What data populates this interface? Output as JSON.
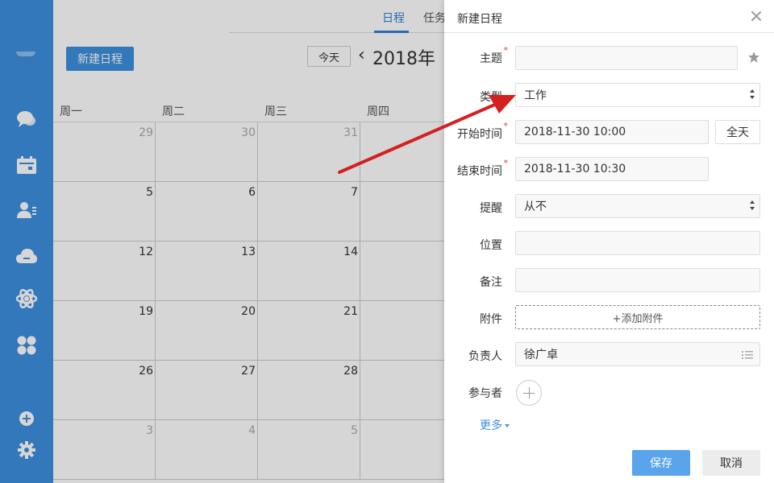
{
  "nav": {
    "tab_schedule": "日程",
    "tab_tasks": "任务"
  },
  "toolbar": {
    "new_schedule": "新建日程",
    "today": "今天",
    "prev": "‹",
    "year": "2018年 "
  },
  "weekdays": [
    "周一",
    "周二",
    "周三",
    "周四"
  ],
  "calendar": {
    "rows": [
      [
        "29",
        "30",
        "31",
        ""
      ],
      [
        "5",
        "6",
        "7",
        ""
      ],
      [
        "12",
        "13",
        "14",
        ""
      ],
      [
        "19",
        "20",
        "21",
        ""
      ],
      [
        "26",
        "27",
        "28",
        ""
      ],
      [
        "3",
        "4",
        "5",
        ""
      ]
    ]
  },
  "dialog": {
    "title": "新建日程",
    "subject_label": "主题",
    "subject_value": "",
    "type_label": "类型",
    "type_value": "工作",
    "start_label": "开始时间",
    "start_value": "2018-11-30 10:00",
    "allday": "全天",
    "end_label": "结束时间",
    "end_value": "2018-11-30 10:30",
    "remind_label": "提醒",
    "remind_value": "从不",
    "location_label": "位置",
    "location_value": "",
    "note_label": "备注",
    "note_value": "",
    "attach_label": "附件",
    "attach_button": "+添加附件",
    "owner_label": "负责人",
    "owner_value": "徐广卓",
    "participants_label": "参与者",
    "more": "更多",
    "save": "保存",
    "cancel": "取消"
  },
  "colors": {
    "sidebar": "#3c8fde",
    "accent": "#2f7fd6",
    "save_button": "#5aa4ec",
    "annotation_arrow": "#d42020"
  }
}
